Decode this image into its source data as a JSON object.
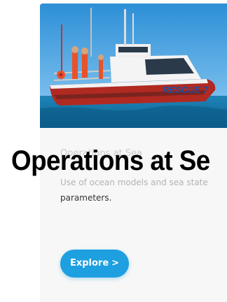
{
  "card": {
    "title": "Operations at Se",
    "ghost_title": "Operations at Sea",
    "description_light": "Use of ocean models and sea state",
    "description_dark": "parameters.",
    "button_label": "Explore",
    "button_icon": "chevron-right-icon"
  },
  "photo": {
    "boat_text": "RESCUE 7"
  },
  "colors": {
    "accent": "#1e9fe0",
    "panel": "#f7f7f7"
  }
}
